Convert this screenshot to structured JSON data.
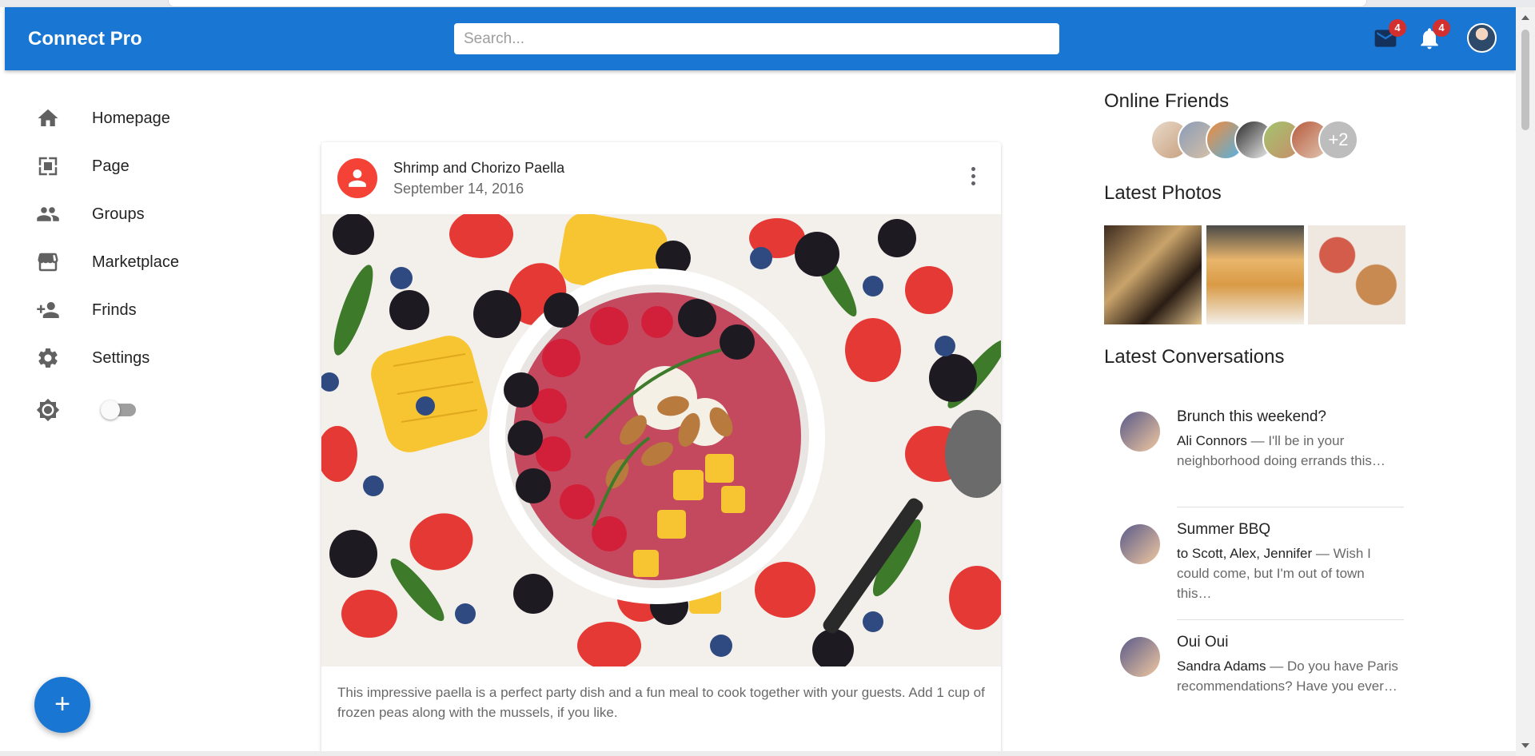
{
  "appbar": {
    "brand": "Connect Pro",
    "search_placeholder": "Search...",
    "mail_badge": "4",
    "notifications_badge": "4",
    "color": "#1976d2"
  },
  "sidebar": {
    "items": [
      {
        "label": "Homepage",
        "icon": "home-icon"
      },
      {
        "label": "Page",
        "icon": "page-icon"
      },
      {
        "label": "Groups",
        "icon": "groups-icon"
      },
      {
        "label": "Marketplace",
        "icon": "storefront-icon"
      },
      {
        "label": "Frinds",
        "icon": "person-add-icon"
      },
      {
        "label": "Settings",
        "icon": "gear-icon"
      }
    ],
    "theme_toggle_icon": "brightness-icon",
    "theme_toggle_on": false
  },
  "fab": {
    "label": "+"
  },
  "post": {
    "title": "Shrimp and Chorizo Paella",
    "date": "September 14, 2016",
    "text": "This impressive paella is a perfect party dish and a fun meal to cook together with your guests. Add 1 cup of frozen peas along with the mussels, if you like.",
    "avatar_color": "#f44336"
  },
  "right": {
    "online_friends_title": "Online Friends",
    "more_friends": "+2",
    "latest_photos_title": "Latest Photos",
    "latest_conversations_title": "Latest Conversations",
    "conversations": [
      {
        "title": "Brunch this weekend?",
        "who": "Ali Connors",
        "snippet": " — I'll be in your neighborhood doing errands this…"
      },
      {
        "title": "Summer BBQ",
        "who": "to Scott, Alex, Jennifer",
        "snippet": " — Wish I could come, but I'm out of town this…"
      },
      {
        "title": "Oui Oui",
        "who": "Sandra Adams",
        "snippet": " — Do you have Paris recommendations? Have you ever…"
      }
    ]
  }
}
